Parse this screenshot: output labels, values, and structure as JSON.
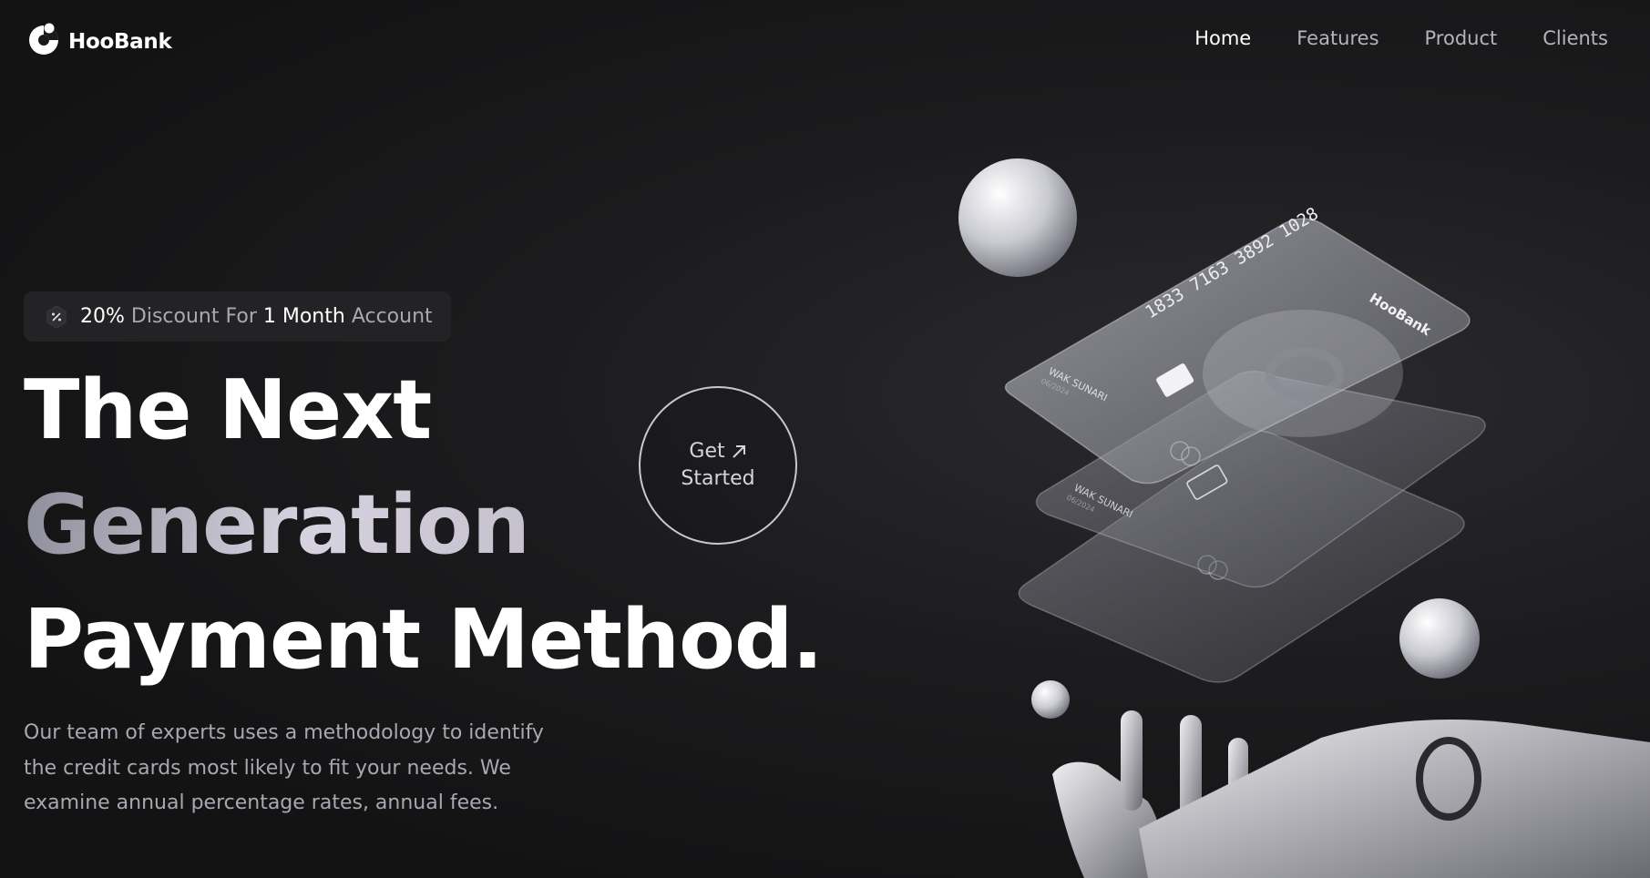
{
  "brand": {
    "name": "HooBank"
  },
  "nav": {
    "items": [
      {
        "label": "Home",
        "active": true
      },
      {
        "label": "Features",
        "active": false
      },
      {
        "label": "Product",
        "active": false
      },
      {
        "label": "Clients",
        "active": false
      }
    ]
  },
  "promo": {
    "icon": "discount-icon",
    "percent": "20%",
    "text1": "Discount For",
    "period": "1 Month",
    "text2": "Account"
  },
  "hero": {
    "line1": "The Next",
    "line2": "Generation",
    "line3": "Payment Method.",
    "description": "Our team of experts uses a methodology to identify the credit cards most likely to fit your needs. We examine annual percentage rates, annual fees."
  },
  "cta": {
    "line1": "Get",
    "line2": "Started",
    "icon": "arrow-up-right-icon"
  },
  "card": {
    "number": "1833 7163 3892 1028",
    "holder": "WAK SUNARI",
    "expiry": "06/2024",
    "brand": "HooBank"
  },
  "colors": {
    "background": "#131314",
    "text_muted": "#a8a8b2",
    "accent_gradient_start": "#8e8e9a",
    "accent_gradient_end": "#d6d2e0"
  }
}
